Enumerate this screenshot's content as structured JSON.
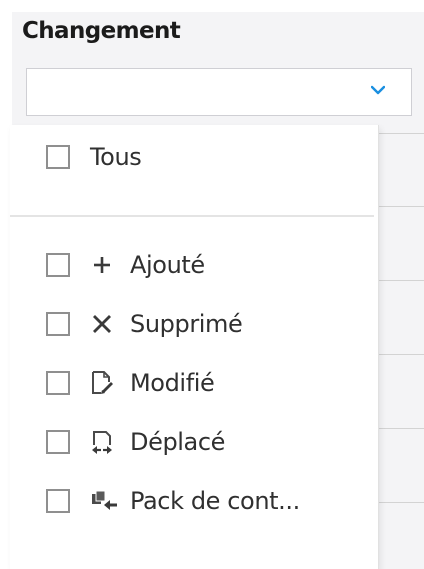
{
  "filter": {
    "title": "Changement",
    "selected_value": ""
  },
  "dropdown": {
    "all_option": {
      "label": "Tous",
      "checked": false
    },
    "options": [
      {
        "label": "Ajouté",
        "icon": "plus-icon",
        "checked": false
      },
      {
        "label": "Supprimé",
        "icon": "x-icon",
        "checked": false
      },
      {
        "label": "Modifié",
        "icon": "edit-document-icon",
        "checked": false
      },
      {
        "label": "Déplacé",
        "icon": "move-document-icon",
        "checked": false
      },
      {
        "label": "Pack de cont...",
        "icon": "content-pack-icon",
        "checked": false
      }
    ]
  },
  "colors": {
    "accent": "#1a8fe0",
    "header_background": "#f4f4f6",
    "checkbox_border": "#8f8f8f",
    "text": "#303030"
  }
}
